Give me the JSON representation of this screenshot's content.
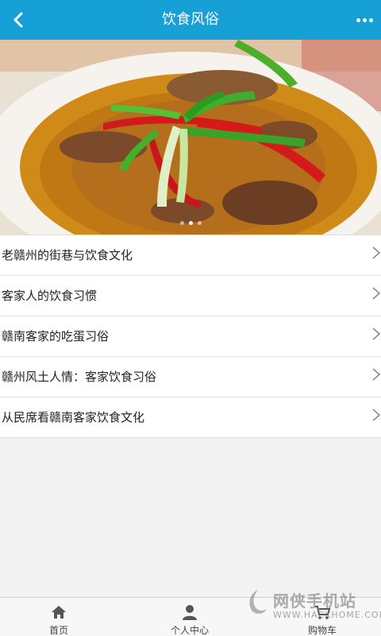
{
  "header": {
    "title": "饮食风俗"
  },
  "banner": {
    "slide_count": 3,
    "active_index": 1
  },
  "articles": [
    {
      "label": "老赣州的街巷与饮食文化"
    },
    {
      "label": "客家人的饮食习惯"
    },
    {
      "label": "赣南客家的吃蛋习俗"
    },
    {
      "label": "赣州风土人情：客家饮食习俗"
    },
    {
      "label": "从民席看赣南客家饮食文化"
    }
  ],
  "tabbar": {
    "tabs": [
      {
        "label": "首页",
        "icon": "home-icon"
      },
      {
        "label": "个人中心",
        "icon": "user-icon"
      },
      {
        "label": "购物车",
        "icon": "cart-icon"
      }
    ]
  },
  "watermark": {
    "title": "网侠手机站",
    "url": "WWW.HACKHOME.COM"
  },
  "colors": {
    "header_bg": "#16a0d6",
    "tab_bg": "#f7f7f7",
    "page_bg": "#f3f3f3"
  }
}
